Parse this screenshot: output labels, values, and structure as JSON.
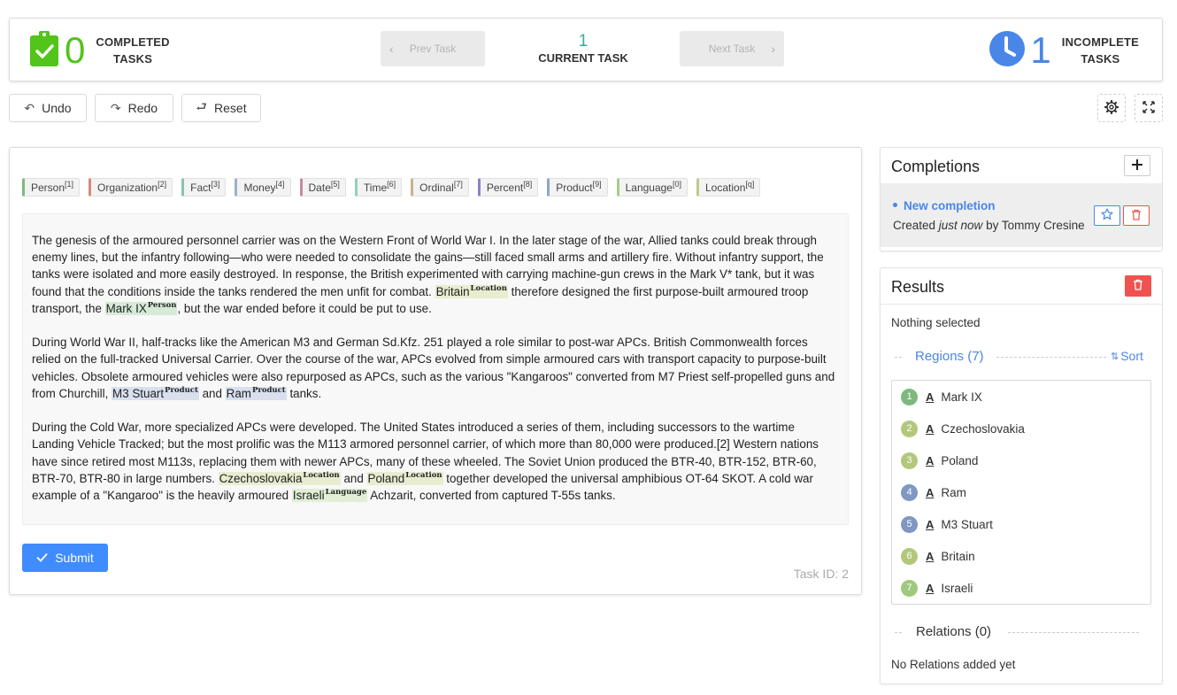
{
  "header": {
    "completed": {
      "count": "0",
      "label_line1": "COMPLETED",
      "label_line2": "TASKS"
    },
    "prev_label": "Prev Task",
    "next_label": "Next Task",
    "current": {
      "number": "1",
      "label": "CURRENT TASK"
    },
    "incomplete": {
      "count": "1",
      "label_line1": "INCOMPLETE",
      "label_line2": "TASKS"
    }
  },
  "toolbar": {
    "undo": "Undo",
    "redo": "Redo",
    "reset": "Reset"
  },
  "labels": [
    {
      "name": "Person",
      "key": "[1]",
      "color": "#7fb87f"
    },
    {
      "name": "Organization",
      "key": "[2]",
      "color": "#d48a7a"
    },
    {
      "name": "Fact",
      "key": "[3]",
      "color": "#86c3b4"
    },
    {
      "name": "Money",
      "key": "[4]",
      "color": "#9ab3c9"
    },
    {
      "name": "Date",
      "key": "[5]",
      "color": "#c98aa0"
    },
    {
      "name": "Time",
      "key": "[6]",
      "color": "#90cfc0"
    },
    {
      "name": "Ordinal",
      "key": "[7]",
      "color": "#c7b48c"
    },
    {
      "name": "Percent",
      "key": "[8]",
      "color": "#8a84c4"
    },
    {
      "name": "Product",
      "key": "[9]",
      "color": "#8fa6c8"
    },
    {
      "name": "Language",
      "key": "[0]",
      "color": "#a7cc8f"
    },
    {
      "name": "Location",
      "key": "[q]",
      "color": "#c2c98a"
    }
  ],
  "text": {
    "p1_a": "The genesis of the armoured personnel carrier was on the Western Front of World War I. In the later stage of the war, Allied tanks could break through enemy lines, but the infantry following—who were needed to consolidate the gains—still faced small arms and artillery fire. Without infantry support, the tanks were isolated and more easily destroyed. In response, the British experimented with carrying machine-gun crews in the Mark V* tank, but it was found that the conditions inside the tanks rendered the men unfit for combat. ",
    "p1_ent1": "Britain",
    "p1_ent1_label": "Location",
    "p1_b": " therefore designed the first purpose-built armoured troop transport, the ",
    "p1_ent2": "Mark IX",
    "p1_ent2_label": "Person",
    "p1_c": ", but the war ended before it could be put to use.",
    "p2_a": "During World War II, half-tracks like the American M3 and German Sd.Kfz. 251 played a role similar to post-war APCs. British Commonwealth forces relied on the full-tracked Universal Carrier. Over the course of the war, APCs evolved from simple armoured cars with transport capacity to purpose-built vehicles. Obsolete armoured vehicles were also repurposed as APCs, such as the various \"Kangaroos\" converted from M7 Priest self-propelled guns and from Churchill, ",
    "p2_ent1": "M3 Stuart",
    "p2_ent1_label": "Product",
    "p2_b": " and ",
    "p2_ent2": "Ram",
    "p2_ent2_label": "Product",
    "p2_c": " tanks.",
    "p3_a": "During the Cold War, more specialized APCs were developed. The United States introduced a series of them, including successors to the wartime Landing Vehicle Tracked; but the most prolific was the M113 armored personnel carrier, of which more than 80,000 were produced.[2] Western nations have since retired most M113s, replacing them with newer APCs, many of these wheeled. The Soviet Union produced the BTR-40, BTR-152, BTR-60, BTR-70, BTR-80 in large numbers. ",
    "p3_ent1": "Czechoslovakia",
    "p3_ent1_label": "Location",
    "p3_b": " and ",
    "p3_ent2": "Poland",
    "p3_ent2_label": "Location",
    "p3_c": " together developed the universal amphibious OT-64 SKOT. A cold war example of a \"Kangaroo\" is the heavily armoured ",
    "p3_ent3": "Israeli",
    "p3_ent3_label": "Language",
    "p3_d": " Achzarit, converted from captured T-55s tanks."
  },
  "submit_label": "Submit",
  "task_id": "Task ID: 2",
  "completions": {
    "title": "Completions",
    "item_name": "New completion",
    "created_prefix": "Created ",
    "created_when": "just now",
    "created_suffix": " by Tommy Cresine"
  },
  "results": {
    "title": "Results",
    "nothing_selected": "Nothing selected",
    "regions_label": "Regions (7)",
    "sort_label": "Sort",
    "regions": [
      {
        "num": "1",
        "text": "Mark IX",
        "color": "#7fb87f"
      },
      {
        "num": "2",
        "text": "Czechoslovakia",
        "color": "#b3c77c"
      },
      {
        "num": "3",
        "text": "Poland",
        "color": "#b3c77c"
      },
      {
        "num": "4",
        "text": "Ram",
        "color": "#7f97c2"
      },
      {
        "num": "5",
        "text": "M3 Stuart",
        "color": "#7f97c2"
      },
      {
        "num": "6",
        "text": "Britain",
        "color": "#b3c77c"
      },
      {
        "num": "7",
        "text": "Israeli",
        "color": "#9ec97f"
      }
    ],
    "relations_label": "Relations (0)",
    "no_relations": "No Relations added yet"
  },
  "colors": {
    "accent": "#4a86e8",
    "completed_green": "#52c41a",
    "submit_blue": "#3f8cff",
    "delete_red": "#ef5350",
    "person_hl": "#d7ead7",
    "location_hl": "#e8edd0",
    "product_hl": "#d8e0ee",
    "language_hl": "#e1efd6"
  }
}
